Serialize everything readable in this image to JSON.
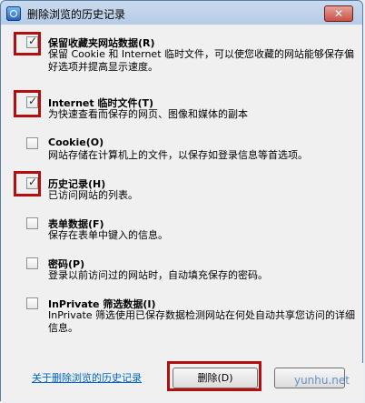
{
  "window": {
    "title": "删除浏览的历史记录"
  },
  "options": [
    {
      "checked": true,
      "label": "保留收藏夹网站数据(R)",
      "description": "保留 Cookie 和 Internet 临时文件，可以使您收藏的网站能够保存偏好选项并提高显示速度。"
    },
    {
      "checked": true,
      "label": "Internet 临时文件(T)",
      "description": "为快速查看而保存的网页、图像和媒体的副本"
    },
    {
      "checked": false,
      "label": "Cookie(O)",
      "description": "网站存储在计算机上的文件，以保存如登录信息等首选项。"
    },
    {
      "checked": true,
      "label": "历史记录(H)",
      "description": "已访问网站的列表。"
    },
    {
      "checked": false,
      "label": "表单数据(F)",
      "description": "保存在表单中键入的信息。"
    },
    {
      "checked": false,
      "label": "密码(P)",
      "description": "登录以前访问过的网站时，自动填充保存的密码。"
    },
    {
      "checked": false,
      "label": "InPrivate 筛选数据(I)",
      "description": "InPrivate 筛选使用已保存数据检测网站在何处自动共享您访问的详细信息。"
    }
  ],
  "footer": {
    "help_link": "关于删除浏览的历史记录",
    "delete_label": "删除(D)",
    "cancel_label": "",
    "watermark": "yunhu.net"
  }
}
